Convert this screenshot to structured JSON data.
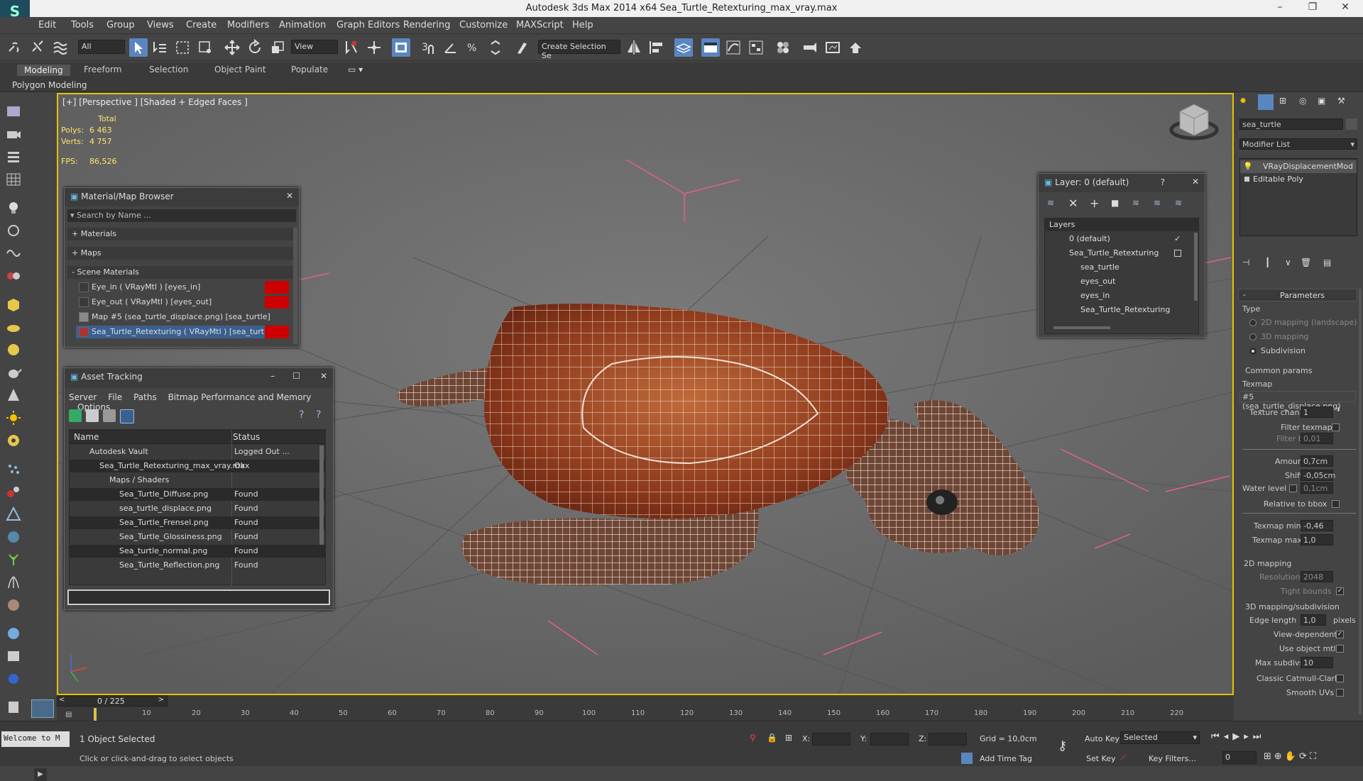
{
  "app": {
    "title": "Autodesk 3ds Max  2014 x64     Sea_Turtle_Retexturing_max_vray.max"
  },
  "menu": [
    "Edit",
    "Tools",
    "Group",
    "Views",
    "Create",
    "Modifiers",
    "Animation",
    "Graph Editors",
    "Rendering",
    "Customize",
    "MAXScript",
    "Help"
  ],
  "toolbar": {
    "filter_value": "All",
    "view_value": "View",
    "selection_set_placeholder": "Create Selection Se"
  },
  "ribbon": {
    "tabs": [
      "Modeling",
      "Freeform",
      "Selection",
      "Object Paint",
      "Populate"
    ],
    "subtitle": "Polygon Modeling"
  },
  "viewport": {
    "label": "[+] [Perspective ] [Shaded + Edged Faces ]",
    "stats_total": "Total",
    "polys_label": "Polys:",
    "polys_value": "6 463",
    "verts_label": "Verts:",
    "verts_value": "4 757",
    "fps_label": "FPS:",
    "fps_value": "86,526"
  },
  "material_browser": {
    "title": "Material/Map Browser",
    "search_placeholder": "Search by Name ...",
    "groups": [
      "+ Materials",
      "+ Maps",
      "- Scene Materials"
    ],
    "items": [
      "Eye_in  ( VRayMtl ) [eyes_in]",
      "Eye_out  ( VRayMtl ) [eyes_out]",
      "Map #5 (sea_turtle_displace.png) [sea_turtle]",
      "Sea_Turtle_Retexturing  ( VRayMtl ) [sea_turtle]"
    ]
  },
  "asset_tracking": {
    "title": "Asset Tracking",
    "menu": [
      "Server",
      "File",
      "Paths",
      "Bitmap Performance and Memory",
      "Options"
    ],
    "col_name": "Name",
    "col_status": "Status",
    "rows": [
      {
        "name": "Autodesk Vault",
        "status": "Logged Out ..."
      },
      {
        "name": "Sea_Turtle_Retexturing_max_vray.max",
        "status": "Ok"
      },
      {
        "name": "Maps / Shaders",
        "status": ""
      },
      {
        "name": "Sea_Turtle_Diffuse.png",
        "status": "Found"
      },
      {
        "name": "sea_turtle_displace.png",
        "status": "Found"
      },
      {
        "name": "Sea_Turtle_Frensel.png",
        "status": "Found"
      },
      {
        "name": "Sea_Turtle_Glossiness.png",
        "status": "Found"
      },
      {
        "name": "Sea_turtle_normal.png",
        "status": "Found"
      },
      {
        "name": "Sea_Turtle_Reflection.png",
        "status": "Found"
      }
    ]
  },
  "layer_panel": {
    "title": "Layer: 0 (default)",
    "help": "?",
    "header": "Layers",
    "items": [
      "0 (default)",
      "Sea_Turtle_Retexturing",
      "sea_turtle",
      "eyes_out",
      "eyes_in",
      "Sea_Turtle_Retexturing"
    ]
  },
  "command_panel": {
    "object_name": "sea_turtle",
    "modifier_list": "Modifier List",
    "stack": [
      "VRayDisplacementMod",
      "Editable Poly"
    ],
    "parameters": "Parameters",
    "type_label": "Type",
    "types": [
      "2D mapping (landscape)",
      "3D mapping",
      "Subdivision"
    ],
    "common_params": "Common params",
    "texmap_label": "Texmap",
    "texmap_value": "#5 (sea_turtle_displace.png)",
    "texture_chan_label": "Texture chan",
    "texture_chan_value": "1",
    "filter_texmap": "Filter texmap",
    "filter_blur_label": "Filter blur",
    "filter_blur_value": "0,01",
    "amount_label": "Amount",
    "amount_value": "0,7cm",
    "shift_label": "Shift",
    "shift_value": "-0,05cm",
    "water_level_label": "Water level",
    "water_level_value": "0,1cm",
    "relative_bbox": "Relative to bbox",
    "texmap_min_label": "Texmap min",
    "texmap_min_value": "-0,46",
    "texmap_max_label": "Texmap max",
    "texmap_max_value": "1,0",
    "mapping2d": "2D mapping",
    "resolution_label": "Resolution",
    "resolution_value": "2048",
    "tight_bounds": "Tight bounds",
    "mapping3d": "3D mapping/subdivision",
    "edge_length_label": "Edge length",
    "edge_length_value": "1,0",
    "pixels": "pixels",
    "view_dependent": "View-dependent",
    "use_object_mtl": "Use object mtl",
    "max_subdivs_label": "Max subdivs",
    "max_subdivs_value": "10",
    "catmull": "Classic Catmull-Clark",
    "smooth_uvs": "Smooth UVs"
  },
  "timeline": {
    "frame": "0 / 225",
    "ticks": [
      "10",
      "20",
      "30",
      "40",
      "50",
      "60",
      "70",
      "80",
      "90",
      "100",
      "110",
      "120",
      "130",
      "140",
      "150",
      "160",
      "170",
      "180",
      "190",
      "200",
      "210",
      "220"
    ]
  },
  "status": {
    "welcome": "Welcome to M",
    "selected": "1 Object Selected",
    "hint": "Click or click-and-drag to select objects",
    "x_label": "X:",
    "y_label": "Y:",
    "z_label": "Z:",
    "grid": "Grid = 10,0cm",
    "add_time_tag": "Add Time Tag",
    "auto_key": "Auto Key",
    "set_key": "Set Key",
    "selected_value": "Selected",
    "key_filters": "Key Filters...",
    "frame_value": "0"
  }
}
